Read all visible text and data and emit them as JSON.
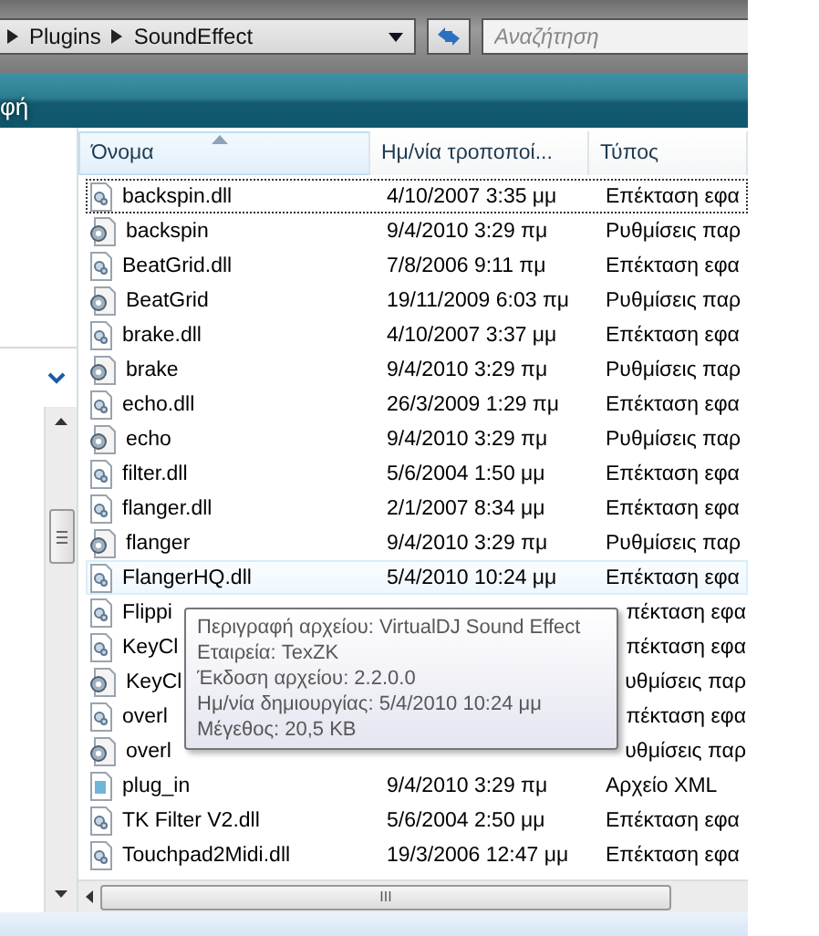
{
  "address_bar": {
    "crumbs": [
      "Plugins",
      "SoundEffect"
    ]
  },
  "search": {
    "placeholder": "Αναζήτηση"
  },
  "toolbar": {
    "items": [
      "φή"
    ]
  },
  "table": {
    "columns": [
      {
        "label": "Όνομα",
        "sorted": true
      },
      {
        "label": "Ημ/νία τροποποί...",
        "sorted": false
      },
      {
        "label": "Τύπος",
        "sorted": false
      }
    ],
    "rows": [
      {
        "kind": "dll",
        "name": "backspin.dll",
        "date": "4/10/2007 3:35 μμ",
        "type": "Επέκταση εφα",
        "focused": true,
        "hot": false
      },
      {
        "kind": "config",
        "name": "backspin",
        "date": "9/4/2010 3:29 πμ",
        "type": "Ρυθμίσεις παρ",
        "focused": false,
        "hot": false
      },
      {
        "kind": "dll",
        "name": "BeatGrid.dll",
        "date": "7/8/2006 9:11 πμ",
        "type": "Επέκταση εφα",
        "focused": false,
        "hot": false
      },
      {
        "kind": "config",
        "name": "BeatGrid",
        "date": "19/11/2009 6:03 πμ",
        "type": "Ρυθμίσεις παρ",
        "focused": false,
        "hot": false
      },
      {
        "kind": "dll",
        "name": "brake.dll",
        "date": "4/10/2007 3:37 μμ",
        "type": "Επέκταση εφα",
        "focused": false,
        "hot": false
      },
      {
        "kind": "config",
        "name": "brake",
        "date": "9/4/2010 3:29 πμ",
        "type": "Ρυθμίσεις παρ",
        "focused": false,
        "hot": false
      },
      {
        "kind": "dll",
        "name": "echo.dll",
        "date": "26/3/2009 1:29 πμ",
        "type": "Επέκταση εφα",
        "focused": false,
        "hot": false
      },
      {
        "kind": "config",
        "name": "echo",
        "date": "9/4/2010 3:29 πμ",
        "type": "Ρυθμίσεις παρ",
        "focused": false,
        "hot": false
      },
      {
        "kind": "dll",
        "name": "filter.dll",
        "date": "5/6/2004 1:50 μμ",
        "type": "Επέκταση εφα",
        "focused": false,
        "hot": false
      },
      {
        "kind": "dll",
        "name": "flanger.dll",
        "date": "2/1/2007 8:34 μμ",
        "type": "Επέκταση εφα",
        "focused": false,
        "hot": false
      },
      {
        "kind": "config",
        "name": "flanger",
        "date": "9/4/2010 3:29 πμ",
        "type": "Ρυθμίσεις παρ",
        "focused": false,
        "hot": false
      },
      {
        "kind": "dll",
        "name": "FlangerHQ.dll",
        "date": "5/4/2010 10:24 μμ",
        "type": "Επέκταση εφα",
        "focused": false,
        "hot": true
      },
      {
        "kind": "dll",
        "name": "Flippi",
        "type": "πέκταση εφα",
        "focused": false,
        "hot": false
      },
      {
        "kind": "dll",
        "name": "KeyCl",
        "type": "πέκταση εφα",
        "focused": false,
        "hot": false
      },
      {
        "kind": "config",
        "name": "KeyCl",
        "type": "υθμίσεις παρ",
        "focused": false,
        "hot": false
      },
      {
        "kind": "dll",
        "name": "overl",
        "type": "πέκταση εφα",
        "focused": false,
        "hot": false
      },
      {
        "kind": "config",
        "name": "overl",
        "type": "υθμίσεις παρ",
        "focused": false,
        "hot": false
      },
      {
        "kind": "xml",
        "name": "plug_in",
        "date": "9/4/2010 3:29 πμ",
        "type": "Αρχείο XML",
        "focused": false,
        "hot": false
      },
      {
        "kind": "dll",
        "name": "TK Filter V2.dll",
        "date": "5/6/2004 2:50 μμ",
        "type": "Επέκταση εφα",
        "focused": false,
        "hot": false
      },
      {
        "kind": "dll",
        "name": "Touchpad2Midi.dll",
        "date": "19/3/2006 12:47 μμ",
        "type": "Επέκταση εφα",
        "focused": false,
        "hot": false
      }
    ]
  },
  "tooltip": {
    "lines": [
      "Περιγραφή αρχείου: VirtualDJ Sound Effect",
      "Εταιρεία: TexZK",
      "Έκδοση αρχείου: 2.2.0.0",
      "Ημ/νία δημιουργίας: 5/4/2010 10:24 μμ",
      "Μέγεθος: 20,5 KB"
    ]
  },
  "horizontal_scrollbar": {
    "grip": "III"
  }
}
